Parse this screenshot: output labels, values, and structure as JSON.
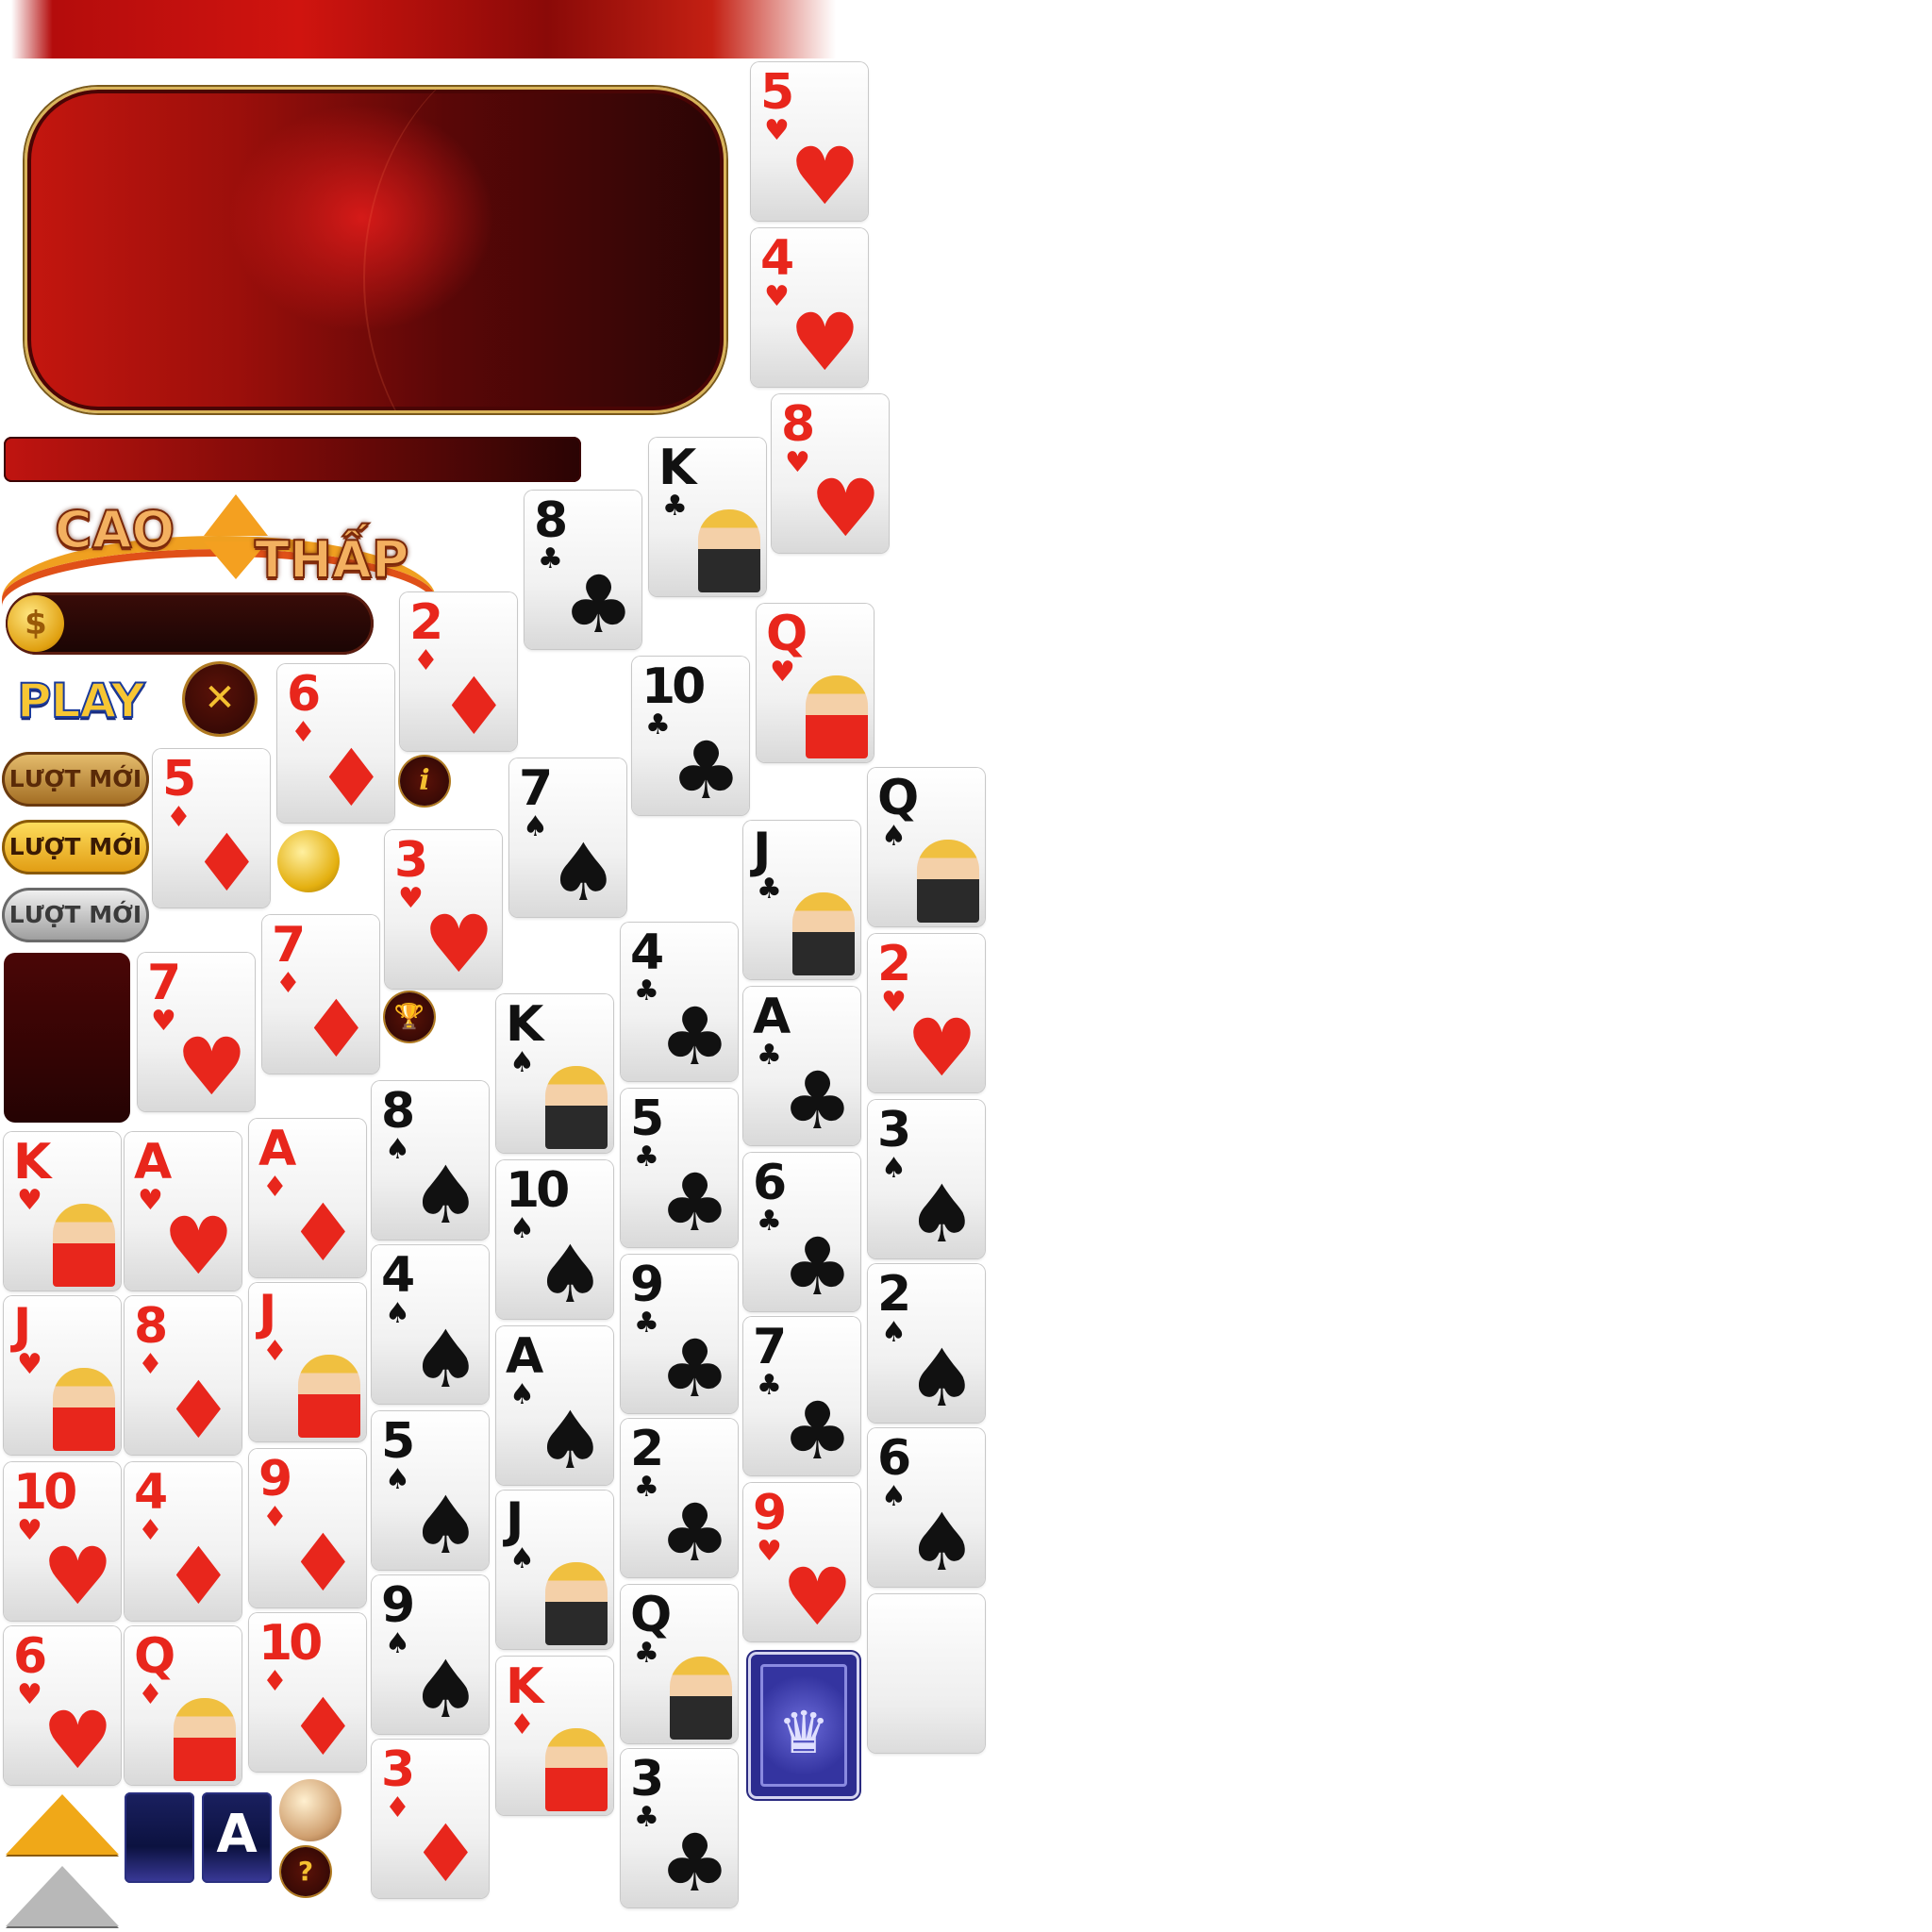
{
  "logo": {
    "word1": "CAO",
    "word2": "THẤP"
  },
  "buttons": {
    "play": "PLAY",
    "close": "✕",
    "luot_moi": [
      "LƯỢT MỚI",
      "LƯỢT MỚI",
      "LƯỢT MỚI"
    ],
    "info": "i",
    "trophy": "🏆",
    "question": "?",
    "coin_symbol": "$",
    "ace_tile": "A"
  },
  "colors": {
    "red_suit": "#e8261c",
    "black_suit": "#111111",
    "panel_red": "#c4160f",
    "gold": "#f4c030",
    "card_back": "#2c2c90"
  },
  "cards": [
    {
      "rank": "5",
      "suit": "♥",
      "color": "red"
    },
    {
      "rank": "4",
      "suit": "♥",
      "color": "red"
    },
    {
      "rank": "8",
      "suit": "♥",
      "color": "red"
    },
    {
      "rank": "K",
      "suit": "♣",
      "color": "black",
      "face": true
    },
    {
      "rank": "8",
      "suit": "♣",
      "color": "black"
    },
    {
      "rank": "2",
      "suit": "♦",
      "color": "red"
    },
    {
      "rank": "Q",
      "suit": "♥",
      "color": "red",
      "face": true
    },
    {
      "rank": "10",
      "suit": "♣",
      "color": "black"
    },
    {
      "rank": "6",
      "suit": "♦",
      "color": "red"
    },
    {
      "rank": "7",
      "suit": "♠",
      "color": "black"
    },
    {
      "rank": "Q",
      "suit": "♠",
      "color": "black",
      "face": true
    },
    {
      "rank": "5",
      "suit": "♦",
      "color": "red"
    },
    {
      "rank": "3",
      "suit": "♥",
      "color": "red"
    },
    {
      "rank": "J",
      "suit": "♣",
      "color": "black",
      "face": true
    },
    {
      "rank": "7",
      "suit": "♦",
      "color": "red"
    },
    {
      "rank": "4",
      "suit": "♣",
      "color": "black"
    },
    {
      "rank": "2",
      "suit": "♥",
      "color": "red"
    },
    {
      "rank": "7",
      "suit": "♥",
      "color": "red"
    },
    {
      "rank": "A",
      "suit": "♣",
      "color": "black"
    },
    {
      "rank": "K",
      "suit": "♠",
      "color": "black",
      "face": true
    },
    {
      "rank": "8",
      "suit": "♠",
      "color": "black"
    },
    {
      "rank": "5",
      "suit": "♣",
      "color": "black"
    },
    {
      "rank": "3",
      "suit": "♠",
      "color": "black"
    },
    {
      "rank": "K",
      "suit": "♥",
      "color": "red",
      "face": true
    },
    {
      "rank": "A",
      "suit": "♥",
      "color": "red"
    },
    {
      "rank": "A",
      "suit": "♦",
      "color": "red"
    },
    {
      "rank": "10",
      "suit": "♠",
      "color": "black"
    },
    {
      "rank": "6",
      "suit": "♣",
      "color": "black"
    },
    {
      "rank": "4",
      "suit": "♠",
      "color": "black"
    },
    {
      "rank": "9",
      "suit": "♣",
      "color": "black"
    },
    {
      "rank": "2",
      "suit": "♠",
      "color": "black"
    },
    {
      "rank": "J",
      "suit": "♥",
      "color": "red",
      "face": true
    },
    {
      "rank": "8",
      "suit": "♦",
      "color": "red"
    },
    {
      "rank": "J",
      "suit": "♦",
      "color": "red",
      "face": true
    },
    {
      "rank": "A",
      "suit": "♠",
      "color": "black"
    },
    {
      "rank": "7",
      "suit": "♣",
      "color": "black"
    },
    {
      "rank": "5",
      "suit": "♠",
      "color": "black"
    },
    {
      "rank": "2",
      "suit": "♣",
      "color": "black"
    },
    {
      "rank": "6",
      "suit": "♠",
      "color": "black"
    },
    {
      "rank": "10",
      "suit": "♥",
      "color": "red"
    },
    {
      "rank": "4",
      "suit": "♦",
      "color": "red"
    },
    {
      "rank": "9",
      "suit": "♦",
      "color": "red"
    },
    {
      "rank": "J",
      "suit": "♠",
      "color": "black",
      "face": true
    },
    {
      "rank": "9",
      "suit": "♥",
      "color": "red"
    },
    {
      "rank": "9",
      "suit": "♠",
      "color": "black"
    },
    {
      "rank": "Q",
      "suit": "♣",
      "color": "black",
      "face": true
    },
    {
      "rank": "6",
      "suit": "♥",
      "color": "red"
    },
    {
      "rank": "Q",
      "suit": "♦",
      "color": "red",
      "face": true
    },
    {
      "rank": "10",
      "suit": "♦",
      "color": "red"
    },
    {
      "rank": "K",
      "suit": "♦",
      "color": "red",
      "face": true
    },
    {
      "rank": "3",
      "suit": "♦",
      "color": "red"
    },
    {
      "rank": "3",
      "suit": "♣",
      "color": "black"
    }
  ],
  "card_back_symbol": "♛"
}
